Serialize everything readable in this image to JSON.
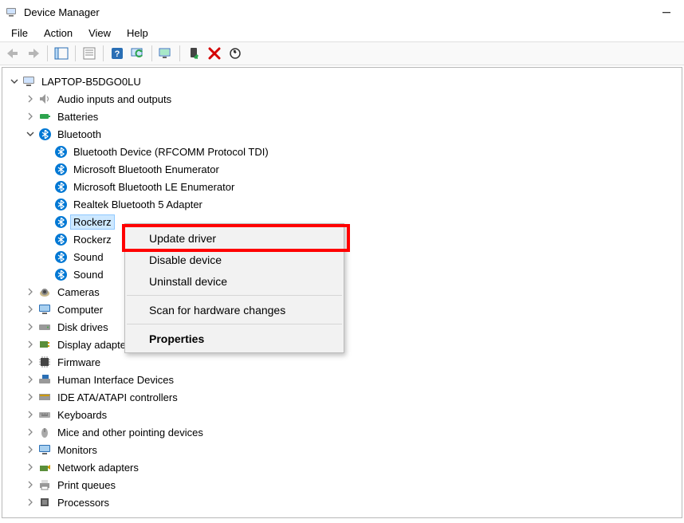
{
  "window": {
    "title": "Device Manager"
  },
  "menu": {
    "file": "File",
    "action": "Action",
    "view": "View",
    "help": "Help"
  },
  "tree": {
    "root": "LAPTOP-B5DGO0LU",
    "audio": "Audio inputs and outputs",
    "batteries": "Batteries",
    "bluetooth": "Bluetooth",
    "bt_children": {
      "rfcomm": "Bluetooth Device (RFCOMM Protocol TDI)",
      "enumerator": "Microsoft Bluetooth Enumerator",
      "le_enum": "Microsoft Bluetooth LE Enumerator",
      "realtek": "Realtek Bluetooth 5 Adapter",
      "rockerz1": "Rockerz",
      "rockerz2": "Rockerz",
      "sound1": "Sound",
      "sound2": "Sound"
    },
    "cameras": "Cameras",
    "computer": "Computer",
    "disks": "Disk drives",
    "display": "Display adapters",
    "firmware": "Firmware",
    "hid": "Human Interface Devices",
    "ide": "IDE ATA/ATAPI controllers",
    "keyboards": "Keyboards",
    "mice": "Mice and other pointing devices",
    "monitors": "Monitors",
    "network": "Network adapters",
    "printq": "Print queues",
    "processors": "Processors"
  },
  "context_menu": {
    "update": "Update driver",
    "disable": "Disable device",
    "uninstall": "Uninstall device",
    "scan": "Scan for hardware changes",
    "properties": "Properties"
  }
}
